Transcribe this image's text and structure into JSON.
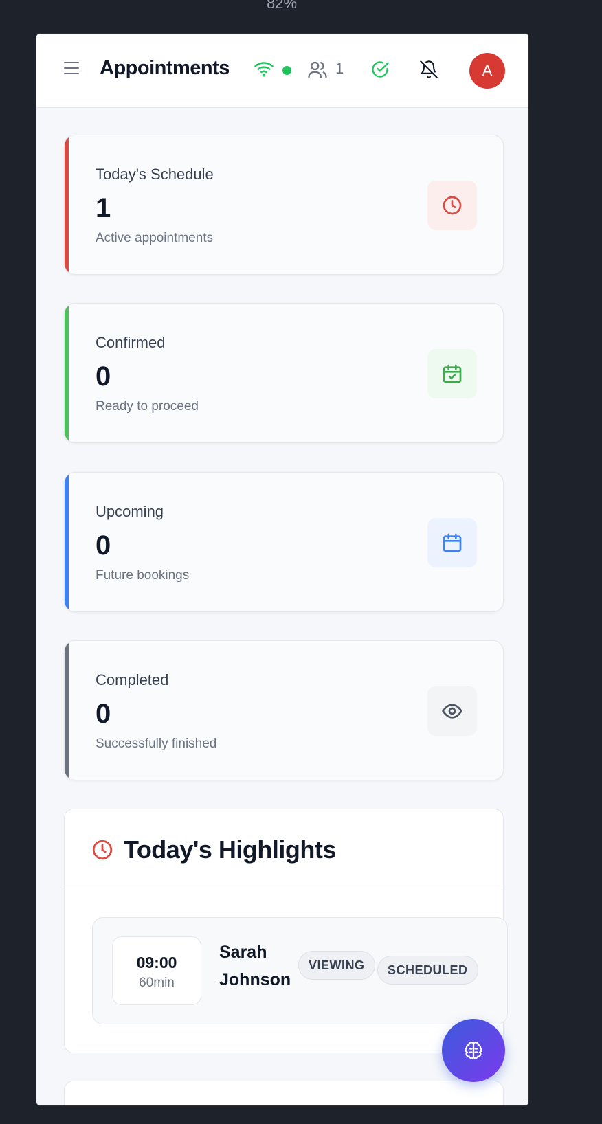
{
  "zoom": "82%",
  "header": {
    "title": "Appointments",
    "users_count": "1",
    "avatar_initial": "A"
  },
  "stats": [
    {
      "label": "Today's Schedule",
      "value": "1",
      "sub": "Active appointments",
      "accent": "#dc4b42",
      "icon": "clock-icon"
    },
    {
      "label": "Confirmed",
      "value": "0",
      "sub": "Ready to proceed",
      "accent": "#4cc25a",
      "icon": "calendar-check-icon"
    },
    {
      "label": "Upcoming",
      "value": "0",
      "sub": "Future bookings",
      "accent": "#3b82f6",
      "icon": "calendar-icon"
    },
    {
      "label": "Completed",
      "value": "0",
      "sub": "Successfully finished",
      "accent": "#6b7280",
      "icon": "eye-icon"
    }
  ],
  "highlights": {
    "title": "Today's Highlights",
    "appointment": {
      "time": "09:00",
      "duration": "60min",
      "client": "Sarah Johnson",
      "type": "VIEWING",
      "status": "SCHEDULED"
    }
  },
  "colors": {
    "brand_red": "#d63a32",
    "online_green": "#22c55e",
    "fab_gradient_start": "#3b5bdb",
    "fab_gradient_end": "#7c3aed"
  }
}
